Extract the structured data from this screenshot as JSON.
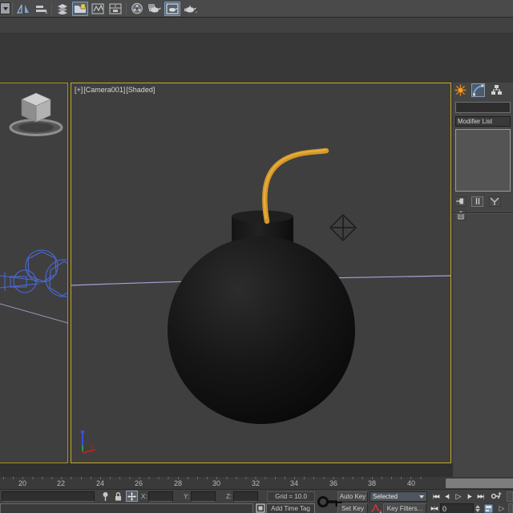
{
  "toolbar": {
    "buttons": [
      {
        "name": "selection-set-dropdown"
      },
      {
        "name": "mirror-button"
      },
      {
        "name": "align-button"
      },
      {
        "name": "layer-manager-button"
      },
      {
        "name": "scene-explorer-button",
        "pressed": true
      },
      {
        "name": "curve-editor-button"
      },
      {
        "name": "schematic-view-button"
      },
      {
        "name": "material-editor-button"
      },
      {
        "name": "render-setup-button"
      },
      {
        "name": "rendered-frame-window-button",
        "pressed": true
      },
      {
        "name": "render-production-button"
      }
    ]
  },
  "viewports": {
    "camera": {
      "label_expand": "[+]",
      "label_name": "[Camera001]",
      "label_shading": "[Shaded]"
    }
  },
  "command_panel": {
    "tabs": [
      {
        "name": "create-tab"
      },
      {
        "name": "modify-tab",
        "active": true
      },
      {
        "name": "hierarchy-tab"
      },
      {
        "name": "motion-tab"
      }
    ],
    "object_name_value": "",
    "modifier_list_label": "Modifier List",
    "stack_buttons": [
      {
        "name": "pin-stack-button"
      },
      {
        "name": "show-end-result-button"
      },
      {
        "name": "make-unique-button"
      },
      {
        "name": "remove-modifier-button"
      }
    ]
  },
  "timeline": {
    "ticks": [
      "20",
      "22",
      "24",
      "26",
      "28",
      "30",
      "32",
      "34",
      "36",
      "38",
      "40"
    ]
  },
  "status_bar": {
    "x_label": "X:",
    "y_label": "Y:",
    "z_label": "Z:",
    "x_value": "",
    "y_value": "",
    "z_value": "",
    "grid_label": "Grid = 10.0",
    "add_time_tag_label": "Add Time Tag",
    "auto_key_label": "Auto Key",
    "set_key_label": "Set Key",
    "selection_set_value": "Selected",
    "key_filters_label": "Key Filters...",
    "frame_number": "0"
  },
  "icons": {
    "go_start": "|◀◀",
    "prev_frame": "◀||",
    "play": "▷",
    "next_frame": "||▶",
    "go_end": "▶▶|",
    "key_mode": "▶|◀",
    "forward_arrow": "▷"
  },
  "colors": {
    "viewport_border_active": "#c4a92a",
    "fuse_orange": "#d4982a",
    "horizon_purple": "#a8a0d8",
    "wireframe_blue": "#4a6ad8",
    "toolbar_bg": "#4a4a4a",
    "panel_bg": "#454545"
  }
}
